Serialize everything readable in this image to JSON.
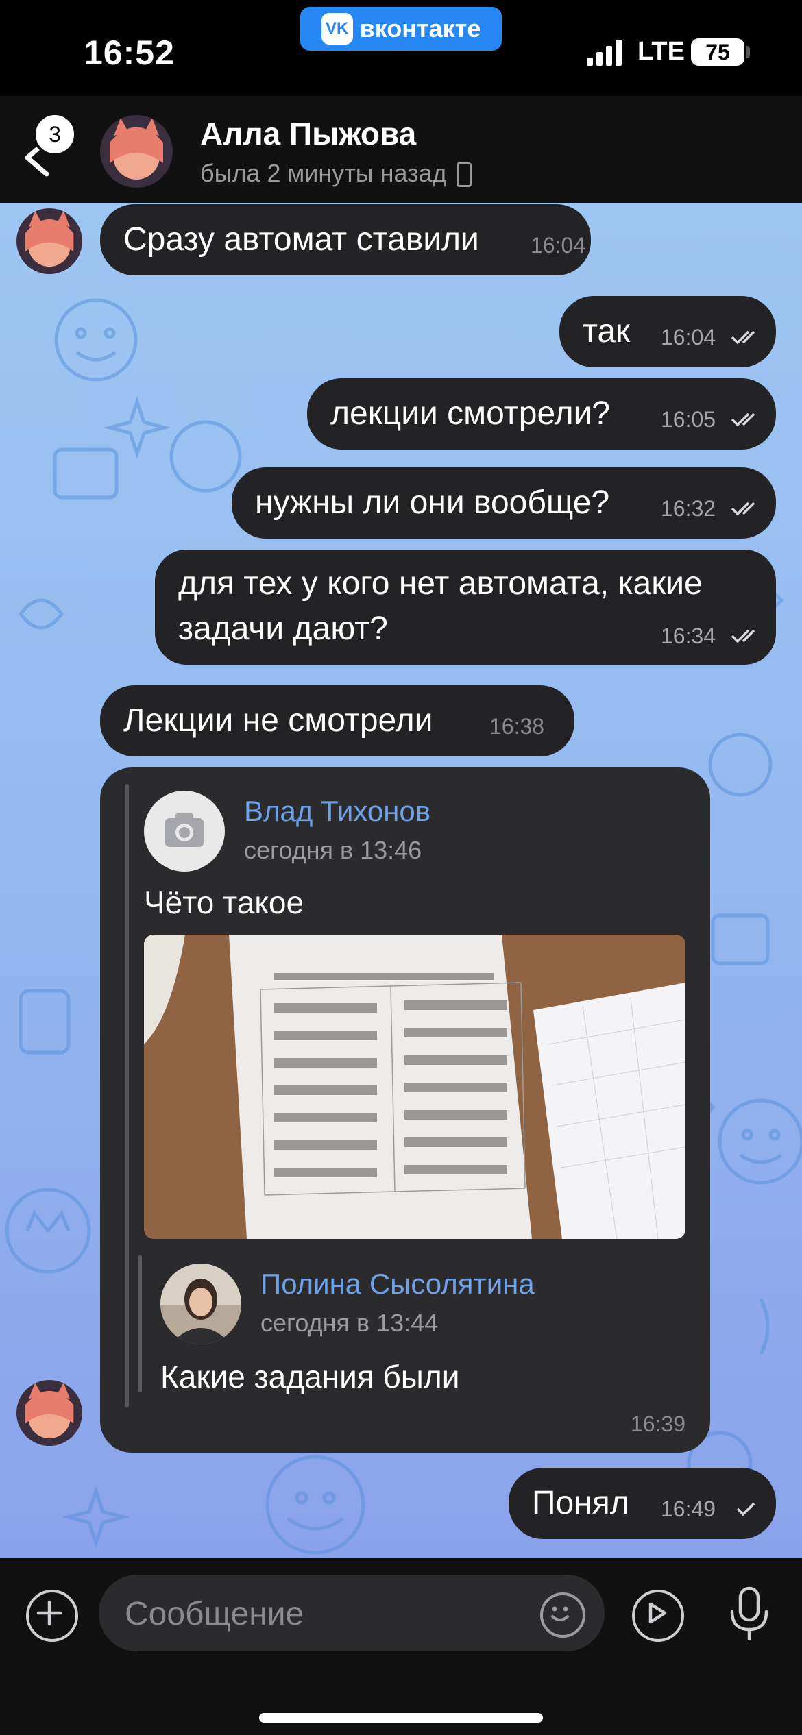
{
  "status_bar": {
    "time": "16:52",
    "network": "LTE",
    "battery": "75",
    "app_pill": "вконтакте",
    "vk_logo": "VK"
  },
  "header": {
    "unread_badge": "3",
    "contact_name": "Алла Пыжова",
    "contact_status": "была 2 минуты назад"
  },
  "messages": [
    {
      "text": "Сразу автомат ставили",
      "time": "16:04",
      "direction": "in"
    },
    {
      "text": "так",
      "time": "16:04",
      "direction": "out",
      "read": true
    },
    {
      "text": "лекции смотрели?",
      "time": "16:05",
      "direction": "out",
      "read": true
    },
    {
      "text": "нужны ли они вообще?",
      "time": "16:32",
      "direction": "out",
      "read": true
    },
    {
      "text_line1": "для тех у кого нет автомата, какие",
      "text_line2": "задачи дают?",
      "time": "16:34",
      "direction": "out",
      "read": true
    },
    {
      "text": "Лекции не смотрели",
      "time": "16:38",
      "direction": "in"
    },
    {
      "text": "Понял",
      "time": "16:49",
      "direction": "out",
      "read": false
    }
  ],
  "forwarded": {
    "author": "Влад Тихонов",
    "date": "сегодня в 13:46",
    "text": "Чёто такое",
    "photo_icon": "camera-icon",
    "reply": {
      "author": "Полина Сысолятина",
      "date": "сегодня в 13:44",
      "text": "Какие задания были"
    },
    "time": "16:39"
  },
  "input": {
    "placeholder": "Сообщение"
  },
  "colors": {
    "bubble": "#232326",
    "accent_name": "#6ea2e8",
    "vk_blue": "#2787f5",
    "wallpaper": "#9ec6f2"
  }
}
